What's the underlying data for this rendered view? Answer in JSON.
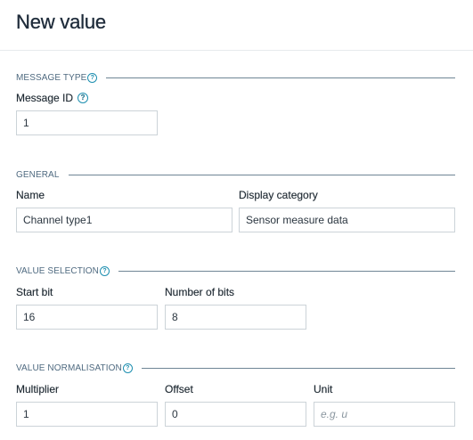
{
  "page": {
    "title": "New value"
  },
  "message_type": {
    "section_title": "MESSAGE TYPE",
    "message_id": {
      "label": "Message ID",
      "value": "1"
    }
  },
  "general": {
    "section_title": "GENERAL",
    "name": {
      "label": "Name",
      "value": "Channel type1"
    },
    "display_category": {
      "label": "Display category",
      "value": "Sensor measure data"
    }
  },
  "value_selection": {
    "section_title": "VALUE SELECTION",
    "start_bit": {
      "label": "Start bit",
      "value": "16"
    },
    "number_of_bits": {
      "label": "Number of bits",
      "value": "8"
    }
  },
  "value_normalisation": {
    "section_title": "VALUE NORMALISATION",
    "multiplier": {
      "label": "Multiplier",
      "value": "1"
    },
    "offset": {
      "label": "Offset",
      "value": "0"
    },
    "unit": {
      "label": "Unit",
      "value": "",
      "placeholder": "e.g. u"
    }
  },
  "icons": {
    "help": "help-circle-icon",
    "help_glyph": "?"
  },
  "colors": {
    "accent": "#1e8fb0",
    "section_text": "#4f6a80",
    "border": "#ccd3d8"
  }
}
